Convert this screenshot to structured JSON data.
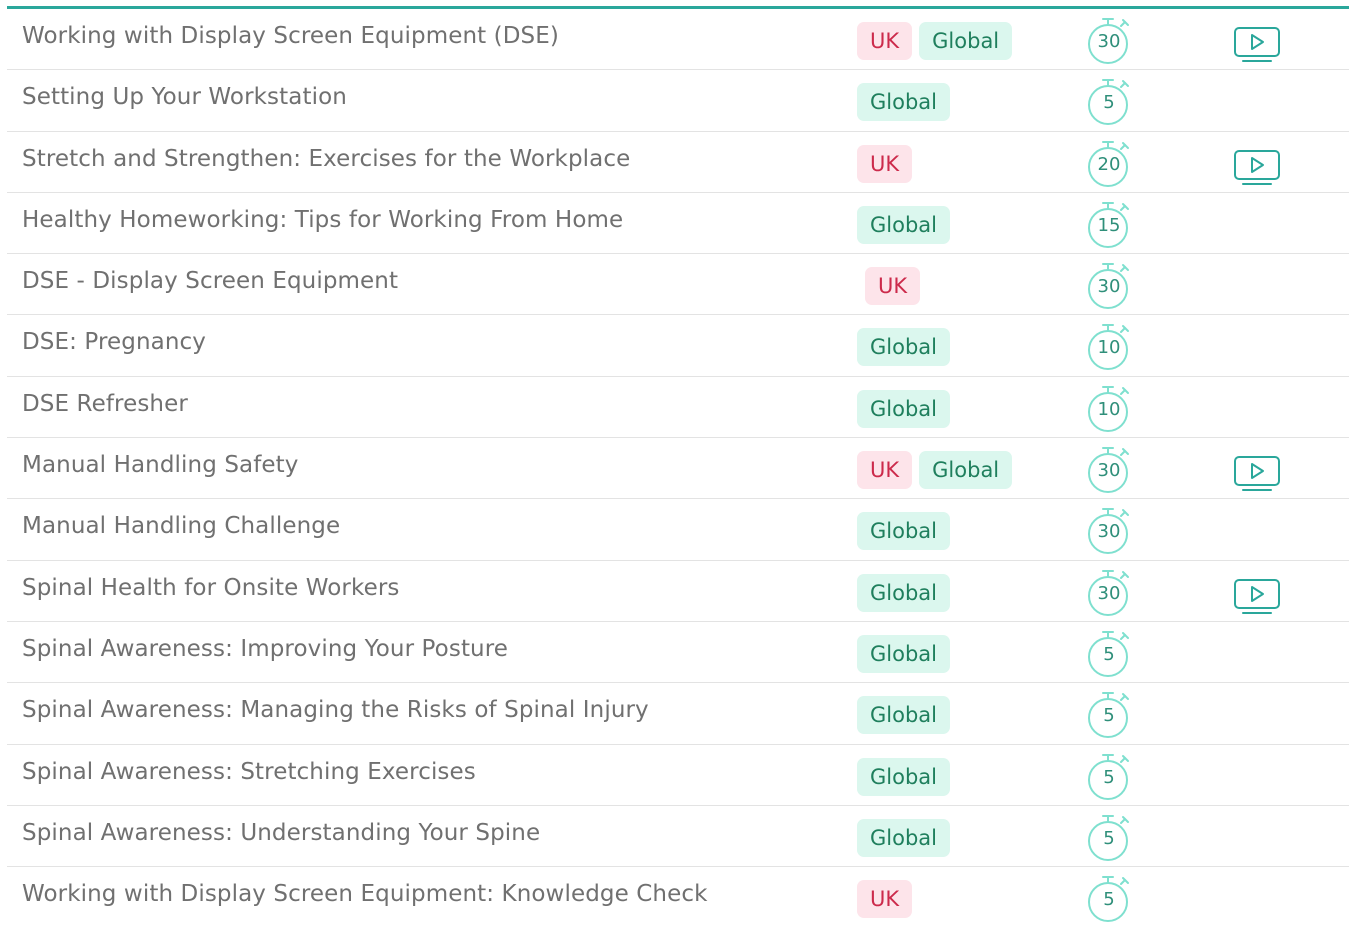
{
  "colors": {
    "accent": "#2aa79b",
    "uk_bg": "#fde4ea",
    "uk_text": "#cc2a4b",
    "global_bg": "#dbf7ee",
    "global_text": "#1f7f5d",
    "timer_stroke": "#7fe0cf",
    "video_stroke": "#2aa79b"
  },
  "courses": [
    {
      "title": "Working with Display Screen Equipment (DSE)",
      "tags": [
        "UK",
        "Global"
      ],
      "duration": "30",
      "video": true
    },
    {
      "title": "Setting Up Your Workstation",
      "tags": [
        "Global"
      ],
      "duration": "5",
      "video": false
    },
    {
      "title": "Stretch and Strengthen: Exercises for the Workplace",
      "tags": [
        "UK"
      ],
      "duration": "20",
      "video": true
    },
    {
      "title": "Healthy Homeworking: Tips for Working From Home",
      "tags": [
        "Global"
      ],
      "duration": "15",
      "video": false
    },
    {
      "title": "DSE - Display Screen Equipment",
      "tags": [
        "UK"
      ],
      "duration": "30",
      "video": false,
      "tag_offset": true
    },
    {
      "title": "DSE: Pregnancy",
      "tags": [
        "Global"
      ],
      "duration": "10",
      "video": false
    },
    {
      "title": "DSE Refresher",
      "tags": [
        "Global"
      ],
      "duration": "10",
      "video": false
    },
    {
      "title": "Manual Handling Safety",
      "tags": [
        "UK",
        "Global"
      ],
      "duration": "30",
      "video": true
    },
    {
      "title": "Manual Handling Challenge",
      "tags": [
        "Global"
      ],
      "duration": "30",
      "video": false
    },
    {
      "title": "Spinal Health for Onsite Workers",
      "tags": [
        "Global"
      ],
      "duration": "30",
      "video": true
    },
    {
      "title": "Spinal Awareness: Improving Your Posture",
      "tags": [
        "Global"
      ],
      "duration": "5",
      "video": false
    },
    {
      "title": "Spinal Awareness: Managing the Risks of Spinal Injury",
      "tags": [
        "Global"
      ],
      "duration": "5",
      "video": false
    },
    {
      "title": "Spinal Awareness: Stretching Exercises",
      "tags": [
        "Global"
      ],
      "duration": "5",
      "video": false
    },
    {
      "title": "Spinal Awareness: Understanding Your Spine",
      "tags": [
        "Global"
      ],
      "duration": "5",
      "video": false
    },
    {
      "title": "Working with Display Screen Equipment: Knowledge Check",
      "tags": [
        "UK"
      ],
      "duration": "5",
      "video": false
    }
  ],
  "icons": {
    "timer": "stopwatch-icon",
    "video": "video-play-icon"
  }
}
